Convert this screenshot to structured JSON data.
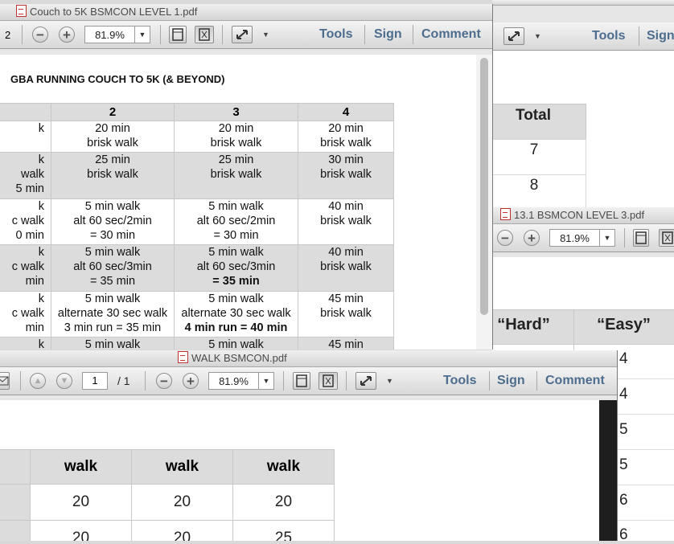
{
  "windows": {
    "couch": {
      "title": "Couch to 5K BSMCON LEVEL 1.pdf",
      "page_fragment": "2",
      "zoom": "81.9%",
      "tools": "Tools",
      "sign": "Sign",
      "comment": "Comment",
      "doc_heading": "GBA RUNNING COUCH TO 5K (& BEYOND)",
      "table": {
        "headers": [
          "",
          "2",
          "3",
          "4"
        ],
        "rows": [
          [
            [
              "k"
            ],
            [
              "20 min",
              "brisk walk"
            ],
            [
              "20 min",
              "brisk walk"
            ],
            [
              "20 min",
              "brisk walk"
            ]
          ],
          [
            [
              "k",
              "walk",
              "5 min"
            ],
            [
              "25 min",
              "brisk walk"
            ],
            [
              "25 min",
              "brisk walk"
            ],
            [
              "30 min",
              "brisk walk"
            ]
          ],
          [
            [
              "k",
              "c walk",
              "0 min"
            ],
            [
              "5 min walk",
              "alt 60 sec/2min",
              "= 30 min"
            ],
            [
              "5 min walk",
              "alt 60 sec/2min",
              "= 30 min"
            ],
            [
              "40 min",
              "brisk walk"
            ]
          ],
          [
            [
              "k",
              "c walk",
              "min"
            ],
            [
              "5 min walk",
              "alt 60 sec/3min",
              "= 35 min"
            ],
            [
              "5 min walk",
              "alt 60 sec/3min",
              "= 35 min"
            ],
            [
              "40 min",
              "brisk walk"
            ]
          ],
          [
            [
              "k",
              "c walk",
              "min"
            ],
            [
              "5 min walk",
              "alternate 30 sec walk",
              "3 min run = 35 min"
            ],
            [
              "5 min walk",
              "alternate 30 sec walk",
              "4 min run = 40 min"
            ],
            [
              "45 min",
              "brisk walk"
            ]
          ],
          [
            [
              "k"
            ],
            [
              "5 min walk"
            ],
            [
              "5 min walk"
            ],
            [
              "45 min"
            ]
          ]
        ]
      }
    },
    "back": {
      "tools": "Tools",
      "sign": "Sign",
      "table_header": "Total",
      "values": [
        "7",
        "8"
      ]
    },
    "level3": {
      "title": "13.1 BSMCON LEVEL 3.pdf",
      "zoom": "81.9%",
      "headers": [
        "“Hard”",
        "“Easy”"
      ],
      "easy_values": [
        "4",
        "4",
        "5",
        "5",
        "6",
        "6"
      ]
    },
    "walk": {
      "title": "WALK BSMCON.pdf",
      "page_input": "1",
      "page_total": "/ 1",
      "zoom": "81.9%",
      "tools": "Tools",
      "sign": "Sign",
      "comment": "Comment",
      "headers": [
        "walk",
        "walk",
        "walk"
      ],
      "rows": [
        [
          "20",
          "20",
          "20"
        ],
        [
          "20",
          "20",
          "25"
        ]
      ]
    }
  }
}
